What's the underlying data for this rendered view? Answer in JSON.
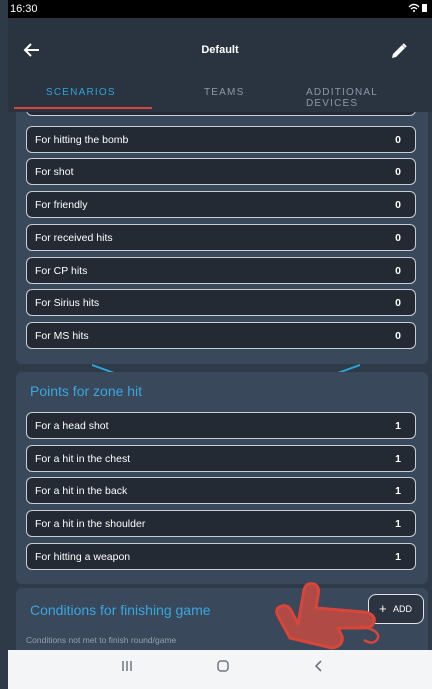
{
  "status_bar": {
    "time": "16:30",
    "system_icons": "wifi-icon battery-icon"
  },
  "app_bar": {
    "title": "Default",
    "back_icon": "arrow-left-icon",
    "edit_icon": "pencil-icon"
  },
  "tabs": [
    {
      "label": "SCENARIOS",
      "active": true
    },
    {
      "label": "TEAMS",
      "active": false
    },
    {
      "label": "ADDITIONAL DEVICES",
      "active": false
    }
  ],
  "hits_rows": [
    {
      "label": "For hitting the bomb",
      "value": "0"
    },
    {
      "label": "For shot",
      "value": "0"
    },
    {
      "label": "For friendly",
      "value": "0"
    },
    {
      "label": "For received hits",
      "value": "0"
    },
    {
      "label": "For CP hits",
      "value": "0"
    },
    {
      "label": "For Sirius hits",
      "value": "0"
    },
    {
      "label": "For MS hits",
      "value": "0"
    }
  ],
  "zone_section": {
    "title": "Points for zone hit",
    "rows": [
      {
        "label": "For a head shot",
        "value": "1"
      },
      {
        "label": "For a hit in the chest",
        "value": "1"
      },
      {
        "label": "For a hit in the back",
        "value": "1"
      },
      {
        "label": "For a hit in the shoulder",
        "value": "1"
      },
      {
        "label": "For hitting a weapon",
        "value": "1"
      }
    ]
  },
  "conditions_section": {
    "title": "Conditions for finishing game",
    "add_label": "ADD",
    "add_icon": "plus-icon",
    "note": "Conditions not met to finish round/game"
  },
  "overlay": {
    "icon": "hand-pointer-icon"
  },
  "nav_bar": {
    "recents_icon": "recents-icon",
    "home_icon": "home-icon",
    "back_icon": "chevron-left-icon"
  },
  "colors": {
    "accent": "#3aa7e0",
    "tab_underline": "#d9453a",
    "card": "#39485a",
    "row": "#232a33",
    "hand": "#d9453a"
  }
}
